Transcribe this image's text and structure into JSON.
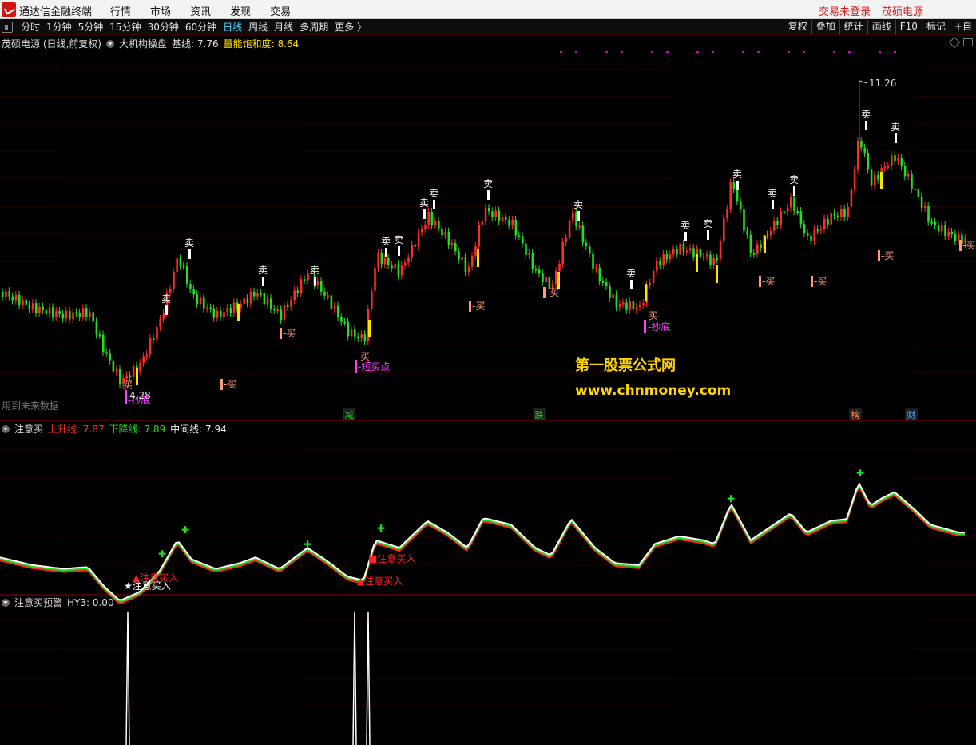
{
  "window": {
    "app_title": "通达信金融终端",
    "menu": [
      "行情",
      "市场",
      "资讯",
      "发现",
      "交易"
    ],
    "login_status": "交易未登录",
    "stock_name": "茂硕电源"
  },
  "toolbar": {
    "periods": [
      "分时",
      "1分钟",
      "5分钟",
      "15分钟",
      "30分钟",
      "60分钟",
      "日线",
      "周线",
      "月线",
      "多周期",
      "更多 〉"
    ],
    "active_period": "日线",
    "right_buttons": [
      "复权",
      "叠加",
      "统计",
      "画线",
      "F10",
      "标记",
      "+自"
    ]
  },
  "main_panel": {
    "title": "茂硕电源 (日线,前复权)",
    "indicator_name": "大机构操盘",
    "baseline_label": "基线: 7.76",
    "saturation_label": "量能饱和度: 8.64",
    "high_label": "11.26",
    "low_label": "4.28",
    "future_data_note": "用到未来数据",
    "watermark_title": "第一股票公式网",
    "watermark_url": "www.chnmoney.com",
    "sell_label": "卖",
    "buy_label": "买",
    "dash_buy_label": "-买",
    "bottom_label": "-抄底",
    "short_buy_label": "-短买点",
    "event_markers": [
      "减",
      "跌",
      "榜",
      "财"
    ],
    "colors": {
      "up": "#ff2a2a",
      "down": "#22dd22",
      "yellow": "#ffe000",
      "sell": "#ffffff",
      "buy": "#ff9a7a",
      "magenta": "#ff3cff"
    }
  },
  "sub_panel_1": {
    "name": "注意买",
    "up_line_label": "上升线: 7.87",
    "down_line_label": "下降线: 7.89",
    "mid_line_label": "中间线: 7.94",
    "signal_label": "注意买入"
  },
  "sub_panel_2": {
    "name": "注意买预警",
    "value_label": "HY3: 0.00"
  }
}
